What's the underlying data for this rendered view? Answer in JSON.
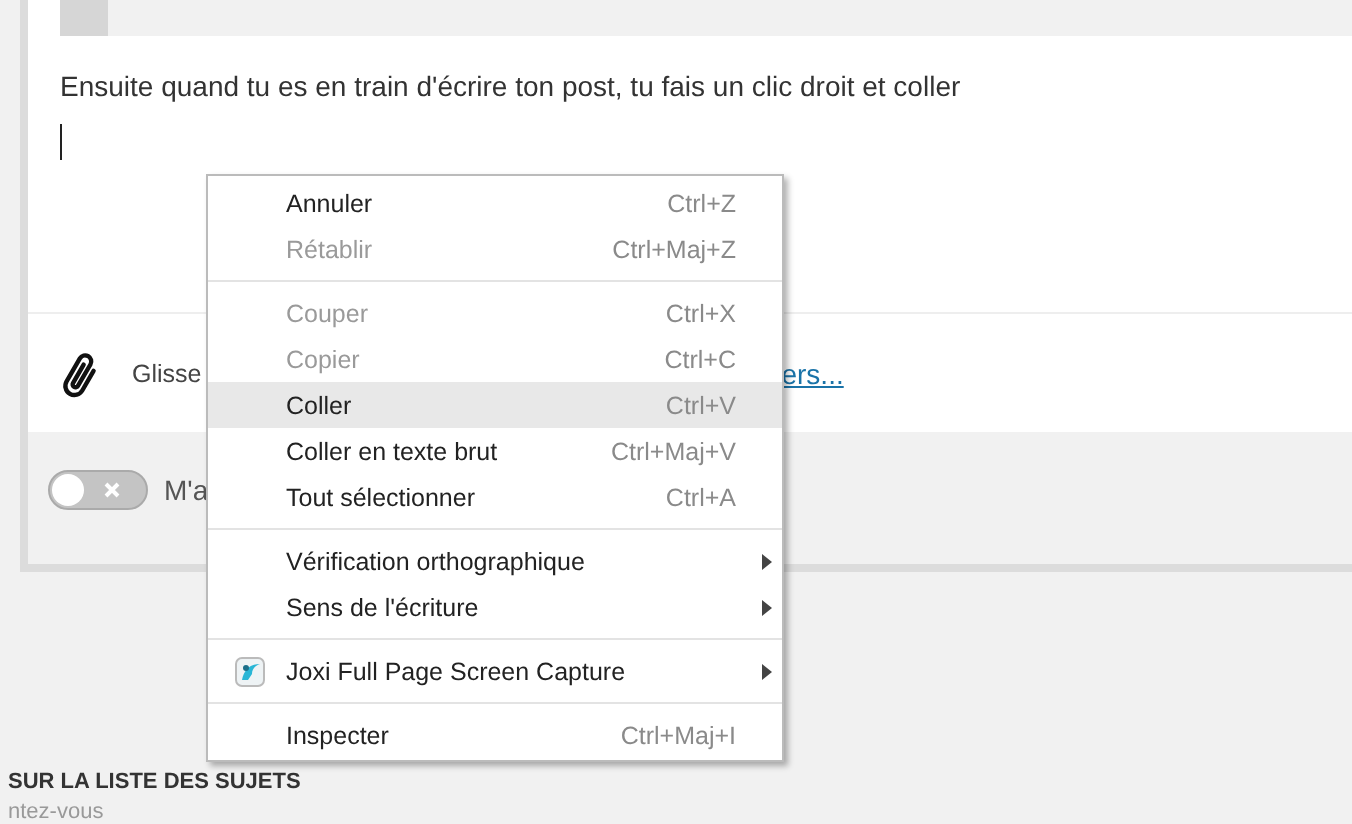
{
  "editor": {
    "text": "Ensuite quand tu es en train d'écrire ton post, tu fais un clic droit et coller"
  },
  "attachments": {
    "label": "Glisse",
    "link": "ers..."
  },
  "notify": {
    "on": false,
    "label": "M'a"
  },
  "footer": {
    "heading": "SUR LA LISTE DES SUJETS",
    "text": "ntez-vous"
  },
  "context_menu": [
    {
      "kind": "command",
      "label": "Annuler",
      "shortcut": "Ctrl+Z",
      "disabled": false,
      "selected": false,
      "submenu": false
    },
    {
      "kind": "command",
      "label": "Rétablir",
      "shortcut": "Ctrl+Maj+Z",
      "disabled": true,
      "selected": false,
      "submenu": false
    },
    {
      "kind": "separator"
    },
    {
      "kind": "command",
      "label": "Couper",
      "shortcut": "Ctrl+X",
      "disabled": true,
      "selected": false,
      "submenu": false
    },
    {
      "kind": "command",
      "label": "Copier",
      "shortcut": "Ctrl+C",
      "disabled": true,
      "selected": false,
      "submenu": false
    },
    {
      "kind": "command",
      "label": "Coller",
      "shortcut": "Ctrl+V",
      "disabled": false,
      "selected": true,
      "submenu": false
    },
    {
      "kind": "command",
      "label": "Coller en texte brut",
      "shortcut": "Ctrl+Maj+V",
      "disabled": false,
      "selected": false,
      "submenu": false
    },
    {
      "kind": "command",
      "label": "Tout sélectionner",
      "shortcut": "Ctrl+A",
      "disabled": false,
      "selected": false,
      "submenu": false
    },
    {
      "kind": "separator"
    },
    {
      "kind": "command",
      "label": "Vérification orthographique",
      "disabled": false,
      "selected": false,
      "submenu": true
    },
    {
      "kind": "command",
      "label": "Sens de l'écriture",
      "disabled": false,
      "selected": false,
      "submenu": true
    },
    {
      "kind": "separator"
    },
    {
      "kind": "extension",
      "label": "Joxi Full Page Screen Capture",
      "disabled": false,
      "selected": false,
      "submenu": true
    },
    {
      "kind": "separator"
    },
    {
      "kind": "command",
      "label": "Inspecter",
      "shortcut": "Ctrl+Maj+I",
      "disabled": false,
      "selected": false,
      "submenu": false
    }
  ]
}
